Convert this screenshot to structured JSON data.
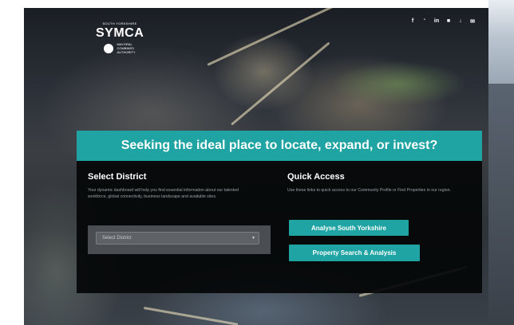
{
  "header": {
    "logo": {
      "top_text": "SOUTH YORKSHIRE",
      "name": "SYMCA",
      "authority_lines": [
        "MAYORAL",
        "COMBINED",
        "AUTHORITY"
      ]
    },
    "social_icons": [
      "f",
      "‘",
      "in",
      "■",
      "↓",
      "✉"
    ]
  },
  "hero": {
    "title": "Seeking the ideal place to locate, expand, or invest?"
  },
  "select_district": {
    "heading": "Select District",
    "description": "Your dynamic dashboard will help you find essential information about our talented workforce, global connectivity, business landscape and available sites.",
    "select_value": "Select District"
  },
  "quick_access": {
    "heading": "Quick Access",
    "description": "Use these links to quick access to our Community Profile or Find Properties in our region.",
    "buttons": [
      "Analyse South Yorkshire",
      "Property Search & Analysis"
    ]
  },
  "colors": {
    "accent": "#1fa3a3",
    "panel": "#050709"
  }
}
